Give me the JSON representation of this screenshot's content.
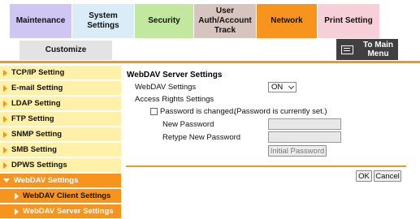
{
  "tabs": {
    "maintenance": "Maintenance",
    "system_settings": "System Settings",
    "security": "Security",
    "user_auth_line1": "User",
    "user_auth_line2": "Auth/Account",
    "user_auth_line3": "Track",
    "network": "Network",
    "print_setting": "Print Setting",
    "customize": "Customize"
  },
  "to_main_menu": {
    "line1": "To Main",
    "line2": "Menu",
    "icon": "menu-icon"
  },
  "sidebar": {
    "items": [
      {
        "label": "TCP/IP Setting"
      },
      {
        "label": "E-mail Setting"
      },
      {
        "label": "LDAP Setting"
      },
      {
        "label": "FTP Setting"
      },
      {
        "label": "SNMP Setting"
      },
      {
        "label": "SMB Setting"
      },
      {
        "label": "DPWS Settings"
      },
      {
        "label": "WebDAV Settings"
      },
      {
        "label": "WebDAV Client Settings"
      },
      {
        "label": "WebDAV Server Settings"
      }
    ]
  },
  "main": {
    "title": "WebDAV Server Settings",
    "webdav_settings_label": "WebDAV Settings",
    "webdav_settings_value": "ON",
    "access_rights_label": "Access Rights Settings",
    "password_changed_label": "Password is changed.",
    "password_status": "(Password is currently set.)",
    "new_password_label": "New Password",
    "retype_password_label": "Retype New Password",
    "initial_password_button": "Initial Password"
  },
  "footer": {
    "ok": "OK",
    "cancel": "Cancel"
  },
  "colors": {
    "accent": "#f7941d",
    "sidebar_bg": "#fff1a8",
    "header_dark": "#404040"
  }
}
